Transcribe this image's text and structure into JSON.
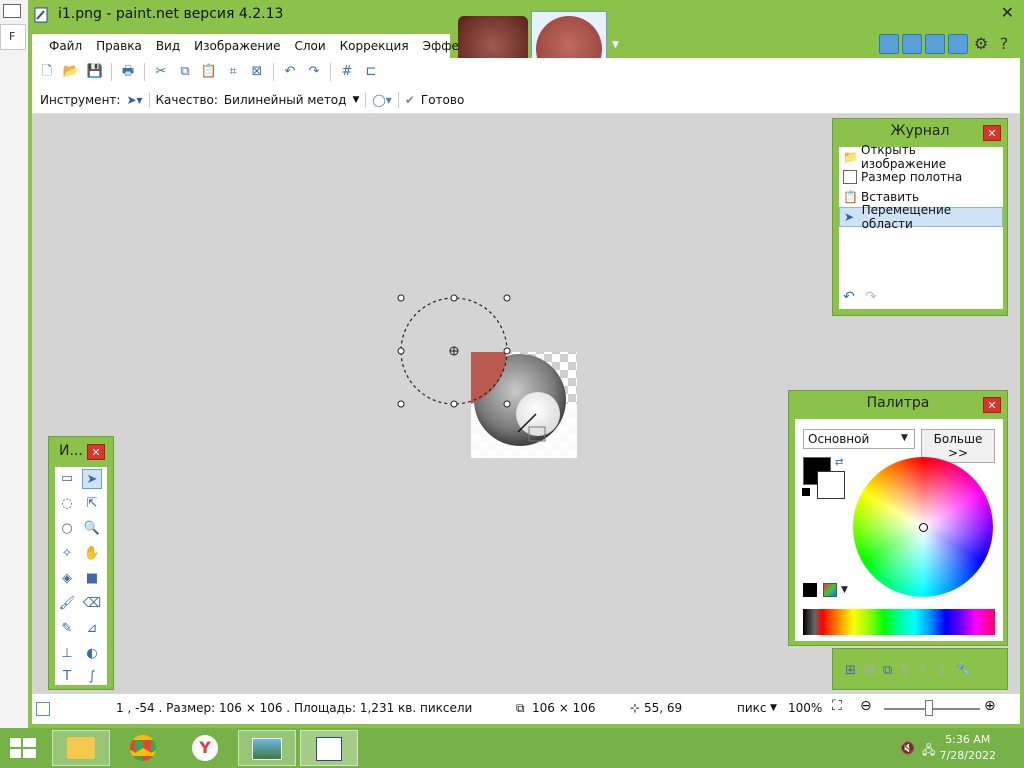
{
  "window": {
    "title": "i1.png - paint.net версия 4.2.13"
  },
  "desktop": {
    "tab_letter": "F"
  },
  "menu": [
    "Файл",
    "Правка",
    "Вид",
    "Изображение",
    "Слои",
    "Коррекция",
    "Эффекты"
  ],
  "options": {
    "tool_label": "Инструмент:",
    "quality_label": "Качество:",
    "quality_value": "Билинейный метод",
    "done_label": "Готово"
  },
  "history": {
    "title": "Журнал",
    "items": [
      "Открыть изображение",
      "Размер полотна",
      "Вставить",
      "Перемещение области"
    ],
    "selected_index": 3
  },
  "tools_panel": {
    "title": "И..."
  },
  "palette": {
    "title": "Палитра",
    "mode": "Основной",
    "more_label": "Больше >>",
    "primary_color": "#000000",
    "secondary_color": "#ffffff"
  },
  "status": {
    "selection_info": "1 , -54 . Размер: 106  × 106 . Площадь: 1,231 кв. пиксели",
    "image_size": "106 × 106",
    "cursor_pos": "55, 69",
    "units": "пикс",
    "zoom": "100%"
  },
  "taskbar": {
    "time": "5:36 AM",
    "date": "7/28/2022"
  },
  "colors": {
    "chrome": "#8bc34a",
    "accent_blue": "#5aa0d8",
    "close_red": "#d9352b"
  }
}
